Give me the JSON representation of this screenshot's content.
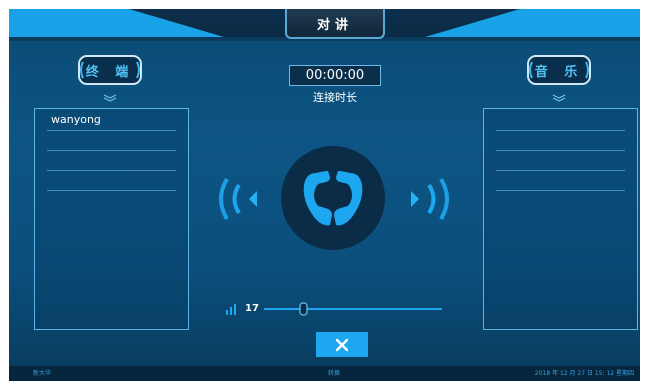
{
  "header": {
    "title": "对讲"
  },
  "left_panel": {
    "button_label": "终 端",
    "items": [
      "wanyong",
      "",
      "",
      "",
      ""
    ]
  },
  "right_panel": {
    "button_label": "音 乐",
    "items": [
      "",
      "",
      "",
      ""
    ]
  },
  "call": {
    "duration": "00:00:00",
    "duration_label": "连接时长"
  },
  "volume": {
    "value": "17",
    "level": 0.2
  },
  "close_button": {
    "label": "✕"
  },
  "footer": {
    "left": "新大华",
    "center": "转换",
    "right": "2018 年 12 月 27 日 15: 12 星期四"
  },
  "colors": {
    "accent": "#1da7f0",
    "panel_border": "#5cb4e2",
    "background": "#0d5584"
  }
}
